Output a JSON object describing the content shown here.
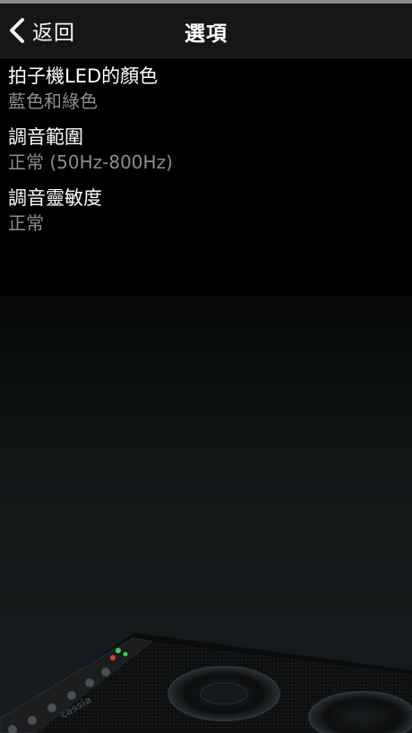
{
  "nav": {
    "back_label": "返回",
    "title": "選項"
  },
  "settings": [
    {
      "title": "拍子機LED的顏色",
      "value": "藍色和綠色"
    },
    {
      "title": "調音範圍",
      "value": "正常 (50Hz-800Hz)"
    },
    {
      "title": "調音靈敏度",
      "value": "正常"
    }
  ],
  "amp": {
    "brand": "cassia",
    "led_colors": [
      "#e23b2a",
      "#3fd14a",
      "#3fd14a"
    ]
  }
}
